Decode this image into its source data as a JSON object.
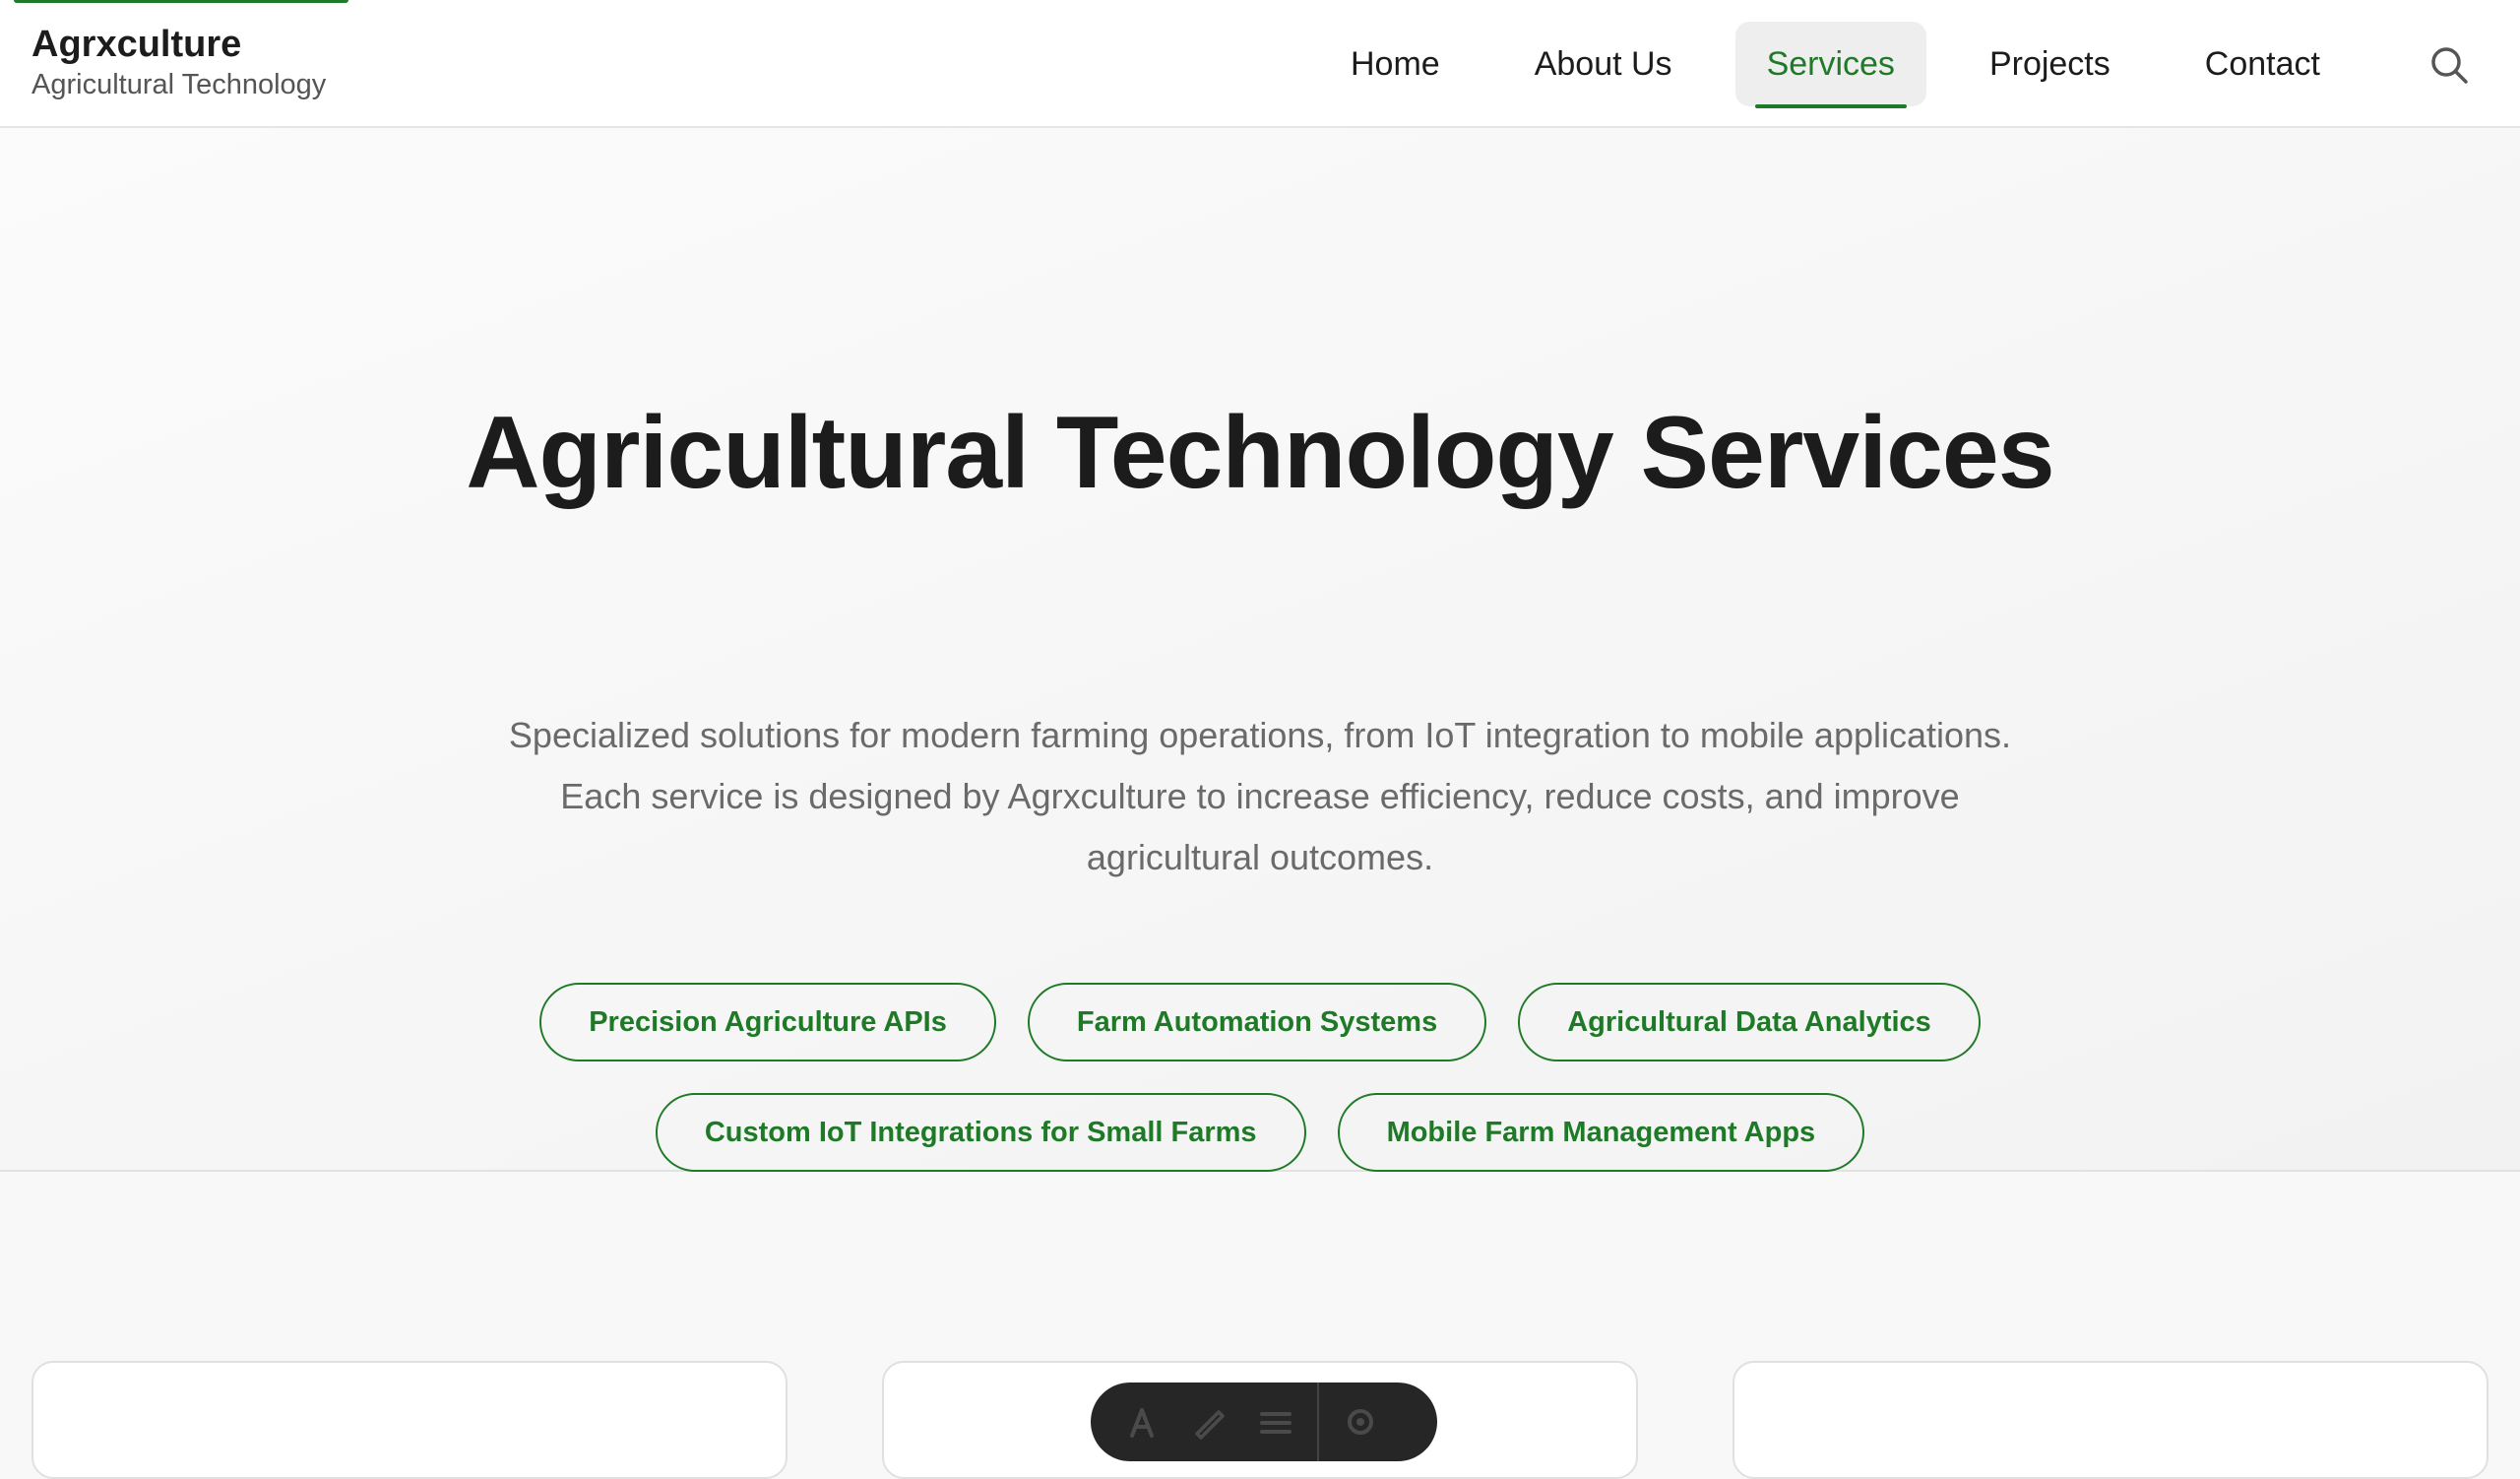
{
  "brand": {
    "name": "Agrxculture",
    "tagline": "Agricultural Technology"
  },
  "nav": {
    "items": [
      {
        "label": "Home",
        "active": false
      },
      {
        "label": "About Us",
        "active": false
      },
      {
        "label": "Services",
        "active": true
      },
      {
        "label": "Projects",
        "active": false
      },
      {
        "label": "Contact",
        "active": false
      }
    ],
    "search_icon": "search-icon"
  },
  "hero": {
    "title": "Agricultural Technology Services",
    "description": "Specialized solutions for modern farming operations, from IoT integration to mobile applications. Each service is designed by Agrxculture to increase efficiency, reduce costs, and improve agricultural outcomes."
  },
  "services": [
    "Precision Agriculture APIs",
    "Farm Automation Systems",
    "Agricultural Data Analytics",
    "Custom IoT Integrations for Small Farms",
    "Mobile Farm Management Apps"
  ],
  "toolbar": {
    "icons": [
      "text-icon",
      "draw-icon",
      "list-icon",
      "settings-icon"
    ]
  },
  "colors": {
    "accent": "#1f7a28",
    "text": "#1c1c1c",
    "muted": "#6a6a6a",
    "background": "#f8f8f8"
  }
}
